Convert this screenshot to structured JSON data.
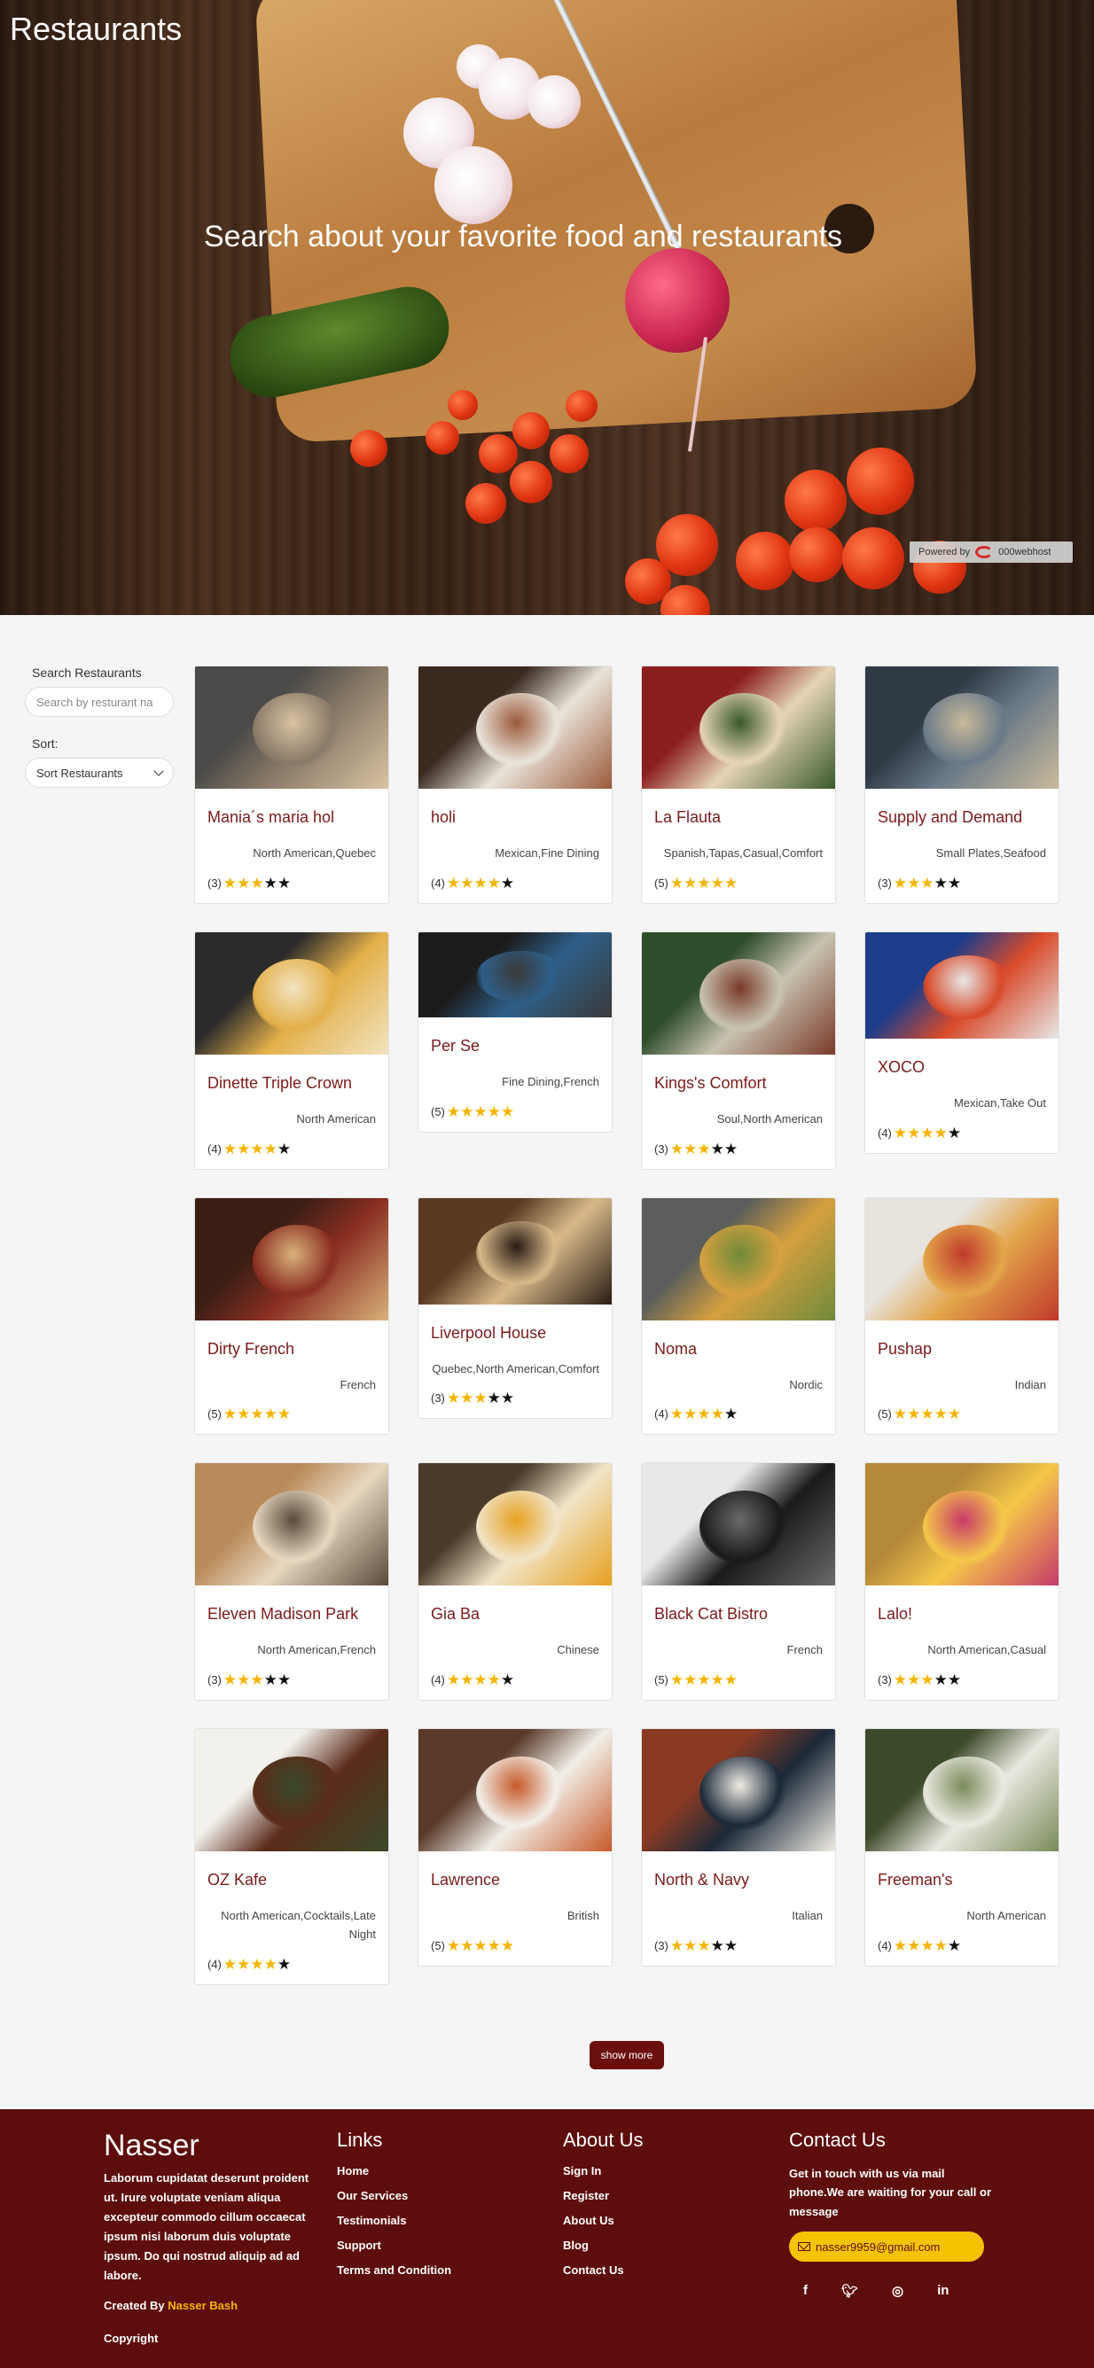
{
  "hero": {
    "title": "Restaurants",
    "tagline": "Search about your favorite food and restaurants",
    "powered_by": "Powered by",
    "powered_brand": "000webhost"
  },
  "sidebar": {
    "search_label": "Search Restaurants",
    "search_placeholder": "Search by resturant na",
    "sort_label": "Sort:",
    "sort_value": "Sort Restaurants"
  },
  "restaurants": [
    {
      "name": "Mania´s maria hol",
      "cuisine": "North American,Quebec",
      "rating_count": "(3)",
      "stars": 3
    },
    {
      "name": "holi",
      "cuisine": "Mexican,Fine Dining",
      "rating_count": "(4)",
      "stars": 4
    },
    {
      "name": "La Flauta",
      "cuisine": "Spanish,Tapas,Casual,Comfort",
      "rating_count": "(5)",
      "stars": 5
    },
    {
      "name": "Supply and Demand",
      "cuisine": "Small Plates,Seafood",
      "rating_count": "(3)",
      "stars": 3
    },
    {
      "name": "Dinette Triple Crown",
      "cuisine": "North American",
      "rating_count": "(4)",
      "stars": 4
    },
    {
      "name": "Per Se",
      "cuisine": "Fine Dining,French",
      "rating_count": "(5)",
      "stars": 5
    },
    {
      "name": "Kings's Comfort",
      "cuisine": "Soul,North American",
      "rating_count": "(3)",
      "stars": 3
    },
    {
      "name": "XOCO",
      "cuisine": "Mexican,Take Out",
      "rating_count": "(4)",
      "stars": 4
    },
    {
      "name": "Dirty French",
      "cuisine": "French",
      "rating_count": "(5)",
      "stars": 5
    },
    {
      "name": "Liverpool House",
      "cuisine": "Quebec,North American,Comfort",
      "rating_count": "(3)",
      "stars": 3
    },
    {
      "name": "Noma",
      "cuisine": "Nordic",
      "rating_count": "(4)",
      "stars": 4
    },
    {
      "name": "Pushap",
      "cuisine": "Indian",
      "rating_count": "(5)",
      "stars": 5
    },
    {
      "name": "Eleven Madison Park",
      "cuisine": "North American,French",
      "rating_count": "(3)",
      "stars": 3
    },
    {
      "name": "Gia Ba",
      "cuisine": "Chinese",
      "rating_count": "(4)",
      "stars": 4
    },
    {
      "name": "Black Cat Bistro",
      "cuisine": "French",
      "rating_count": "(5)",
      "stars": 5
    },
    {
      "name": "Lalo!",
      "cuisine": "North American,Casual",
      "rating_count": "(3)",
      "stars": 3
    },
    {
      "name": "OZ Kafe",
      "cuisine": "North American,Cocktails,Late Night",
      "rating_count": "(4)",
      "stars": 4
    },
    {
      "name": "Lawrence",
      "cuisine": "British",
      "rating_count": "(5)",
      "stars": 5
    },
    {
      "name": "North & Navy",
      "cuisine": "Italian",
      "rating_count": "(3)",
      "stars": 3
    },
    {
      "name": "Freeman's",
      "cuisine": "North American",
      "rating_count": "(4)",
      "stars": 4
    }
  ],
  "show_more_label": "show more",
  "footer": {
    "brand": "Nasser",
    "description": "Laborum cupidatat deserunt proident ut. Irure voluptate veniam aliqua excepteur commodo cillum occaecat ipsum nisi laborum duis voluptate ipsum. Do qui nostrud aliquip ad ad labore.",
    "created_by": "Created By",
    "author": "Nasser Bash",
    "copyright": "Copyright",
    "links_title": "Links",
    "links": [
      "Home",
      "Our Services",
      "Testimonials",
      "Support",
      "Terms and Condition"
    ],
    "about_title": "About Us",
    "about_links": [
      "Sign In",
      "Register",
      "About Us",
      "Blog",
      "Contact Us"
    ],
    "contact_title": "Contact Us",
    "contact_text": "Get in touch with us via mail phone.We are waiting for your call or message",
    "email": "nasser9959@gmail.com",
    "socials": [
      "facebook-icon",
      "twitter-icon",
      "instagram-icon",
      "linkedin-icon"
    ]
  },
  "colors": {
    "accent": "#6b0e0e",
    "footer_bg": "#5e0d0d",
    "star": "#f5b400",
    "name_text": "#7a1a1a"
  }
}
